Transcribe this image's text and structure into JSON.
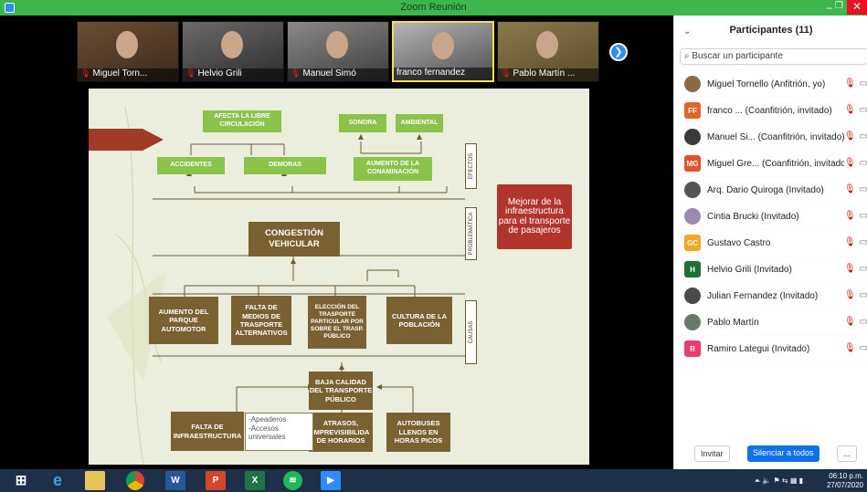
{
  "window": {
    "title": "Zoom Reunión"
  },
  "thumbnails": [
    {
      "name": "Miguel Torn...",
      "muted": true,
      "active": false
    },
    {
      "name": "Helvio Grili",
      "muted": true,
      "active": false
    },
    {
      "name": "Manuel Simó",
      "muted": true,
      "active": false
    },
    {
      "name": "franco fernandez",
      "muted": false,
      "active": true
    },
    {
      "name": "Pablo Martín ...",
      "muted": true,
      "active": false
    }
  ],
  "slide": {
    "effects": {
      "a1": "AFECTA LA LIBRE CIRCULACIÓN",
      "a2": "ACCIDENTES",
      "a3": "DEMORAS",
      "b1": "SONORA",
      "b2": "AMBIENTAL",
      "b3": "AUMENTO DE LA CONAMINACIÓN"
    },
    "side_effects": "EFECTOS",
    "side_problem": "PROBLEMÁTICA",
    "side_causes": "CAUSAS",
    "problem": "CONGESTIÓN VEHICULAR",
    "causes": {
      "c1": "AUMENTO DEL PARQUE AUTOMOTOR",
      "c2": "FALTA DE MEDIOS DE TRASPORTE ALTERNATIVOS",
      "c3": "ELECCIÓN DEL TRASPORTE PARTICULAR POR SOBRE EL TRASP. PÚBLICO",
      "c4": "CULTURA DE LA POBLACIÓN",
      "c5": "BAJA CALIDAD DEL TRANSPORTE PÚBLICO",
      "c6": "FALTA DE INFRAESTRUCTURA",
      "c7": "ATRASOS, IMPREVISIBILIDA DE HORARIOS",
      "c8": "AUTOBUSES LLENOS EN HORAS PICOS"
    },
    "notes": [
      "-Apeaderos",
      "-Accesos universales"
    ],
    "goal": "Mejorar de la infraestructura para el transporte de pasajeros"
  },
  "participants": {
    "title": "Participantes (11)",
    "search_placeholder": "Buscar un participante",
    "list": [
      {
        "initials": "",
        "name": "Miguel Tornello (Anfitrión, yo)",
        "color": "#8b6a4a",
        "photo": true
      },
      {
        "initials": "FF",
        "name": "franco ... (Coanfitrión, invitado)",
        "color": "#e0642b",
        "photo": false
      },
      {
        "initials": "",
        "name": "Manuel Si... (Coanfitrión, invitado)",
        "color": "#3a3a3a",
        "photo": true
      },
      {
        "initials": "MG",
        "name": "Miguel Gre... (Coanfitrión, invitado)",
        "color": "#e0542b",
        "photo": false
      },
      {
        "initials": "",
        "name": "Arq. Dario Quiroga (Invitado)",
        "color": "#555555",
        "photo": true
      },
      {
        "initials": "",
        "name": "Cintia Brucki (Invitado)",
        "color": "#9a8ab0",
        "photo": true
      },
      {
        "initials": "GC",
        "name": "Gustavo Castro",
        "color": "#f5a623",
        "photo": false
      },
      {
        "initials": "H",
        "name": "Helvio Grili (Invitado)",
        "color": "#1f6f3a",
        "photo": false
      },
      {
        "initials": "",
        "name": "Julian Fernandez (Invitado)",
        "color": "#4a4a4a",
        "photo": true
      },
      {
        "initials": "",
        "name": "Pablo Martín",
        "color": "#6a7a6a",
        "photo": true
      },
      {
        "initials": "R",
        "name": "Ramiro Lategui (Invitado)",
        "color": "#e83e6c",
        "photo": false
      }
    ],
    "invite_label": "Invitar",
    "mute_all_label": "Silenciar a todos",
    "more_label": "..."
  },
  "taskbar": {
    "time": "06:10 p.m.",
    "date": "27/07/2020"
  }
}
